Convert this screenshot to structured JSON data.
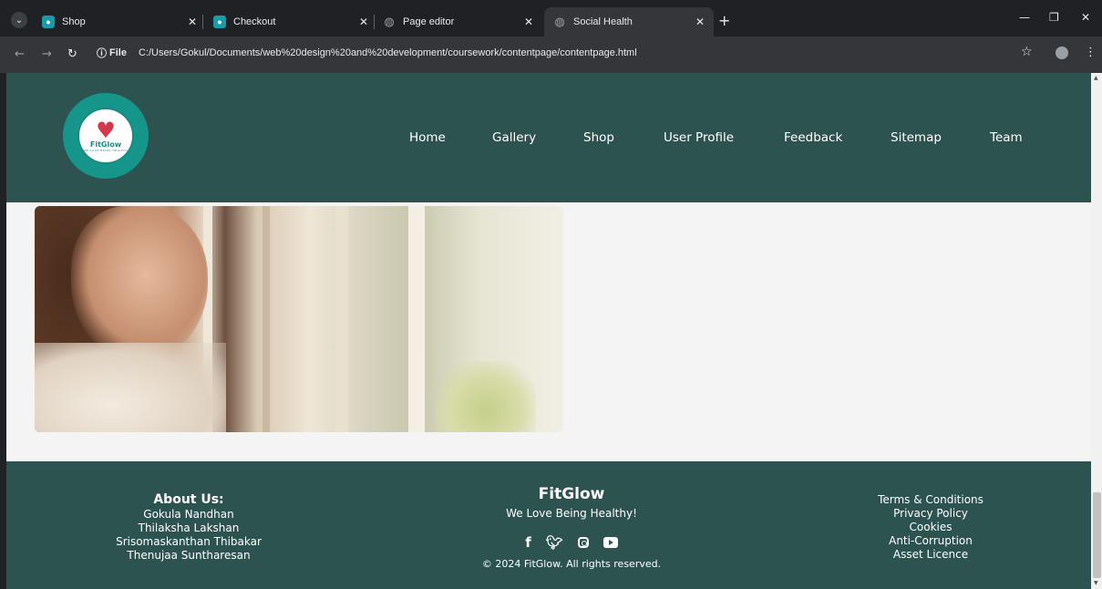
{
  "browser": {
    "tabs": [
      {
        "title": "Shop",
        "favicon": "fitglow-favicon"
      },
      {
        "title": "Checkout",
        "favicon": "fitglow-favicon"
      },
      {
        "title": "Page editor",
        "favicon": "globe-icon"
      },
      {
        "title": "Social Health",
        "favicon": "globe-icon",
        "active": true
      }
    ],
    "file_chip": "File",
    "url": "C:/Users/Gokul/Documents/web%20design%20and%20development/coursework/contentpage/contentpage.html"
  },
  "site": {
    "logo": {
      "name": "FitGlow",
      "tagline": "WE LOVE BEING HEALTHY"
    },
    "nav": [
      "Home",
      "Gallery",
      "Shop",
      "User Profile",
      "Feedback",
      "Sitemap",
      "Team"
    ],
    "hero_image": {
      "alt": "woman looking out of a window"
    }
  },
  "footer": {
    "about_title": "About Us:",
    "members": [
      "Gokula Nandhan",
      "Thilaksha Lakshan",
      "Srisomaskanthan Thibakar",
      "Thenujaa Suntharesan"
    ],
    "brand_name": "FitGlow",
    "brand_tagline": "We Love Being Healthy!",
    "social_icons": [
      "facebook-icon",
      "twitter-icon",
      "instagram-icon",
      "youtube-icon"
    ],
    "copyright": "© 2024 FitGlow. All rights reserved.",
    "links": [
      "Terms & Conditions",
      "Privacy Policy",
      "Cookies",
      "Anti-Corruption",
      "Asset Licence"
    ]
  },
  "colors": {
    "header_bg": "#2d5350",
    "footer_bg": "#2d5350",
    "page_bg": "#f4f4f4",
    "logo_ring": "#16958a"
  }
}
